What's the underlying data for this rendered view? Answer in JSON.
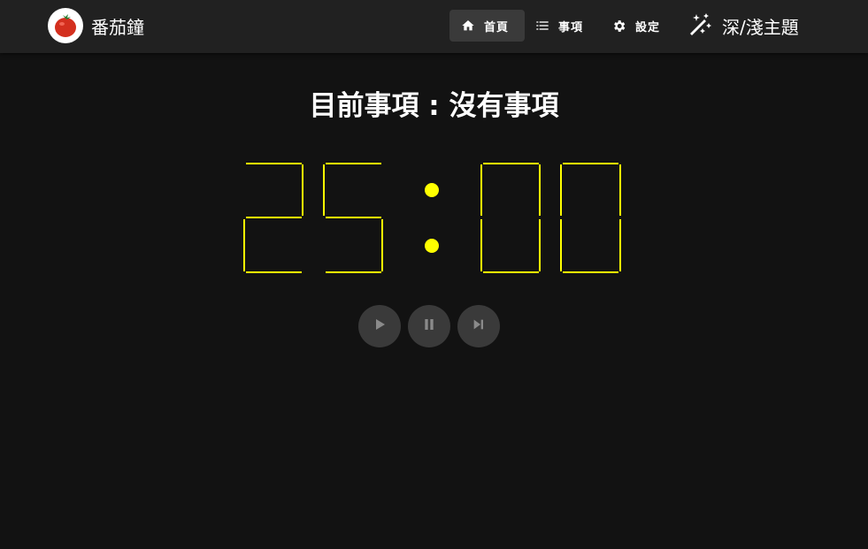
{
  "app": {
    "title": "番茄鐘",
    "logo_icon": "tomato-icon"
  },
  "nav": {
    "items": [
      {
        "label": "首頁",
        "icon": "home-icon",
        "active": true
      },
      {
        "label": "事項",
        "icon": "list-icon",
        "active": false
      },
      {
        "label": "設定",
        "icon": "gear-icon",
        "active": false
      }
    ],
    "theme_toggle": {
      "label": "深/淺主題",
      "icon": "theme-toggle-icon"
    }
  },
  "main": {
    "current_task": "目前事項 : 沒有事項",
    "timer": {
      "display": "25:00",
      "minutes": "25",
      "seconds": "00",
      "color": "#ffff00"
    },
    "controls": [
      {
        "name": "play",
        "icon": "play-icon"
      },
      {
        "name": "pause",
        "icon": "pause-icon"
      },
      {
        "name": "skip",
        "icon": "skip-next-icon"
      }
    ]
  },
  "colors": {
    "background": "#121212",
    "navbar": "#212121",
    "active_nav": "#3a3a3a",
    "accent": "#ffff00",
    "control_button": "#3a3a3a",
    "control_icon": "#8a8a8a"
  }
}
